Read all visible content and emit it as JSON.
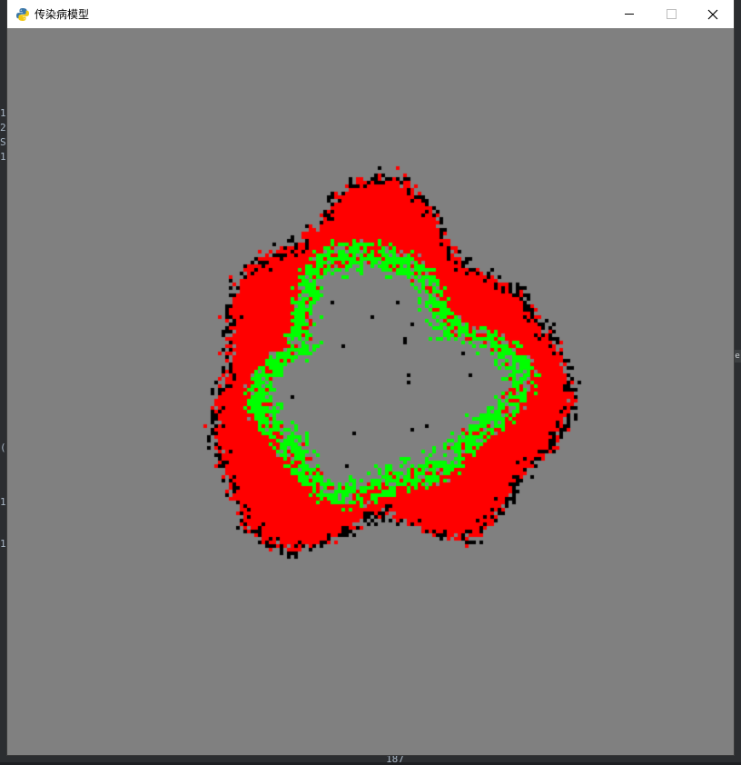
{
  "window": {
    "title": "传染病模型",
    "icon": "python-snake-icon",
    "controls": {
      "minimize": "minimize-icon",
      "maximize": "maximize-icon",
      "close": "close-icon"
    }
  },
  "simulation": {
    "colors": {
      "background": "#808080",
      "infected": "#ff0000",
      "recovered": "#00ff00",
      "dead": "#000000"
    }
  },
  "background_editor": {
    "fragments": [
      "1",
      "2",
      "S",
      "1",
      "(",
      "1",
      "1"
    ],
    "bottom_number": "187",
    "right_stub": "e"
  }
}
